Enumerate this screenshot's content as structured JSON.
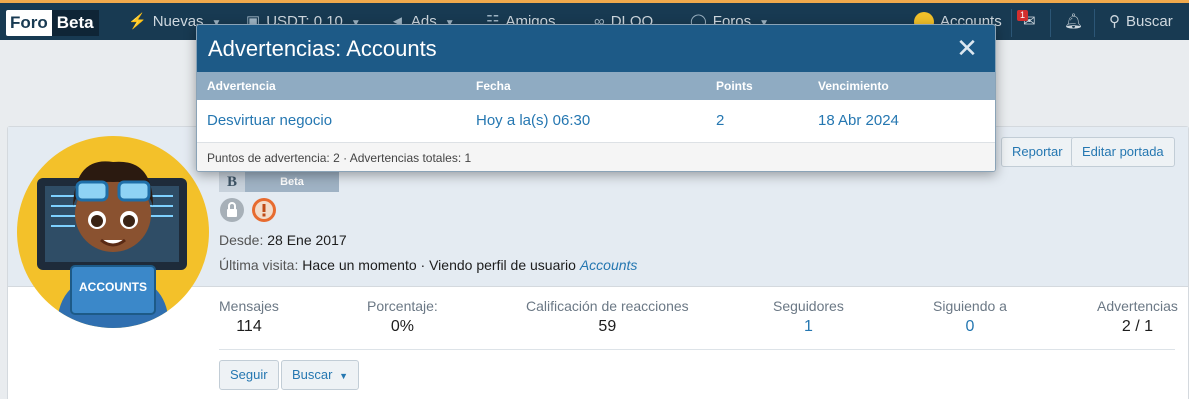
{
  "nav": {
    "logo_left": "Foro",
    "logo_right": "Beta",
    "items": [
      {
        "label": "Nuevas",
        "icon": "bolt-icon"
      },
      {
        "label": "USDT: 0.10",
        "icon": "money-icon"
      },
      {
        "label": "Ads",
        "icon": "megaphone-icon"
      },
      {
        "label": "Amigos",
        "icon": "users-icon"
      },
      {
        "label": "DLOO",
        "icon": "binoculars-icon"
      },
      {
        "label": "Foros",
        "icon": "comments-icon"
      }
    ],
    "user": "Accounts",
    "inbox_count": "1",
    "search": "Buscar"
  },
  "modal": {
    "title": "Advertencias: Accounts",
    "columns": [
      "Advertencia",
      "Fecha",
      "Points",
      "Vencimiento"
    ],
    "rows": [
      [
        "Desvirtuar negocio",
        "Hoy a la(s) 06:30",
        "2",
        "18 Abr 2024"
      ]
    ],
    "footer": "Puntos de advertencia: 2 · Advertencias totales: 1"
  },
  "profile": {
    "avatar_text": "ACCOUNTS",
    "badge_letter": "B",
    "badge_text": "Beta",
    "since_label": "Desde:",
    "since_value": "28 Ene 2017",
    "last_label": "Última visita:",
    "last_value": "Hace un momento · Viendo perfil de usuario",
    "last_link": "Accounts",
    "buttons": {
      "report": "Reportar",
      "edit_cover": "Editar portada",
      "follow": "Seguir",
      "search": "Buscar"
    },
    "stats": [
      {
        "label": "Mensajes",
        "value": "114",
        "link": false
      },
      {
        "label": "Porcentaje:",
        "value": "0%",
        "link": false
      },
      {
        "label": "Calificación de reacciones",
        "value": "59",
        "link": false
      },
      {
        "label": "Seguidores",
        "value": "1",
        "link": true
      },
      {
        "label": "Siguiendo a",
        "value": "0",
        "link": true
      },
      {
        "label": "Advertencias",
        "value": "2 / 1",
        "link": false
      }
    ]
  },
  "colors": {
    "nav_bg": "#183a52",
    "modal_header": "#1d5a87",
    "table_header": "#8fabc2",
    "link": "#2577b1",
    "accent": "#f0a94c"
  }
}
